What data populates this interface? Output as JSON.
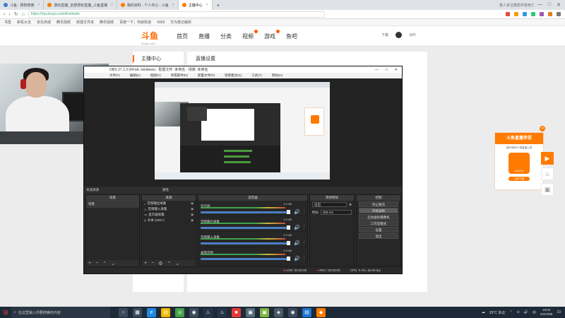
{
  "browser": {
    "tabs": [
      {
        "label": "斗鱼 - 搜狗搜索",
        "active": false
      },
      {
        "label": "游玩直播_全部游玩直播_斗鱼直播",
        "active": false
      },
      {
        "label": "我的资料 - 个人中心 - 斗鱼",
        "active": false
      },
      {
        "label": "主播中心",
        "active": true
      }
    ],
    "new_tab": "+",
    "top_right_text": "老人多注意防中苦死亡",
    "window_controls": [
      "—",
      "□",
      "✕"
    ],
    "url": "https://mp.douyu.com/live/main",
    "bookmarks": [
      "书签",
      "新机大全",
      "京东商城",
      "腾讯视频",
      "新建文件夹",
      "腾讯视频",
      "百度一下，你就知道",
      "4399",
      "华为笔记解析"
    ]
  },
  "site": {
    "logo_text": "斗鱼",
    "logo_sub": "douyu.com",
    "nav": [
      "首页",
      "直播",
      "分类",
      "视频",
      "游戏",
      "鱼吧"
    ],
    "header_right": [
      "下载",
      "马叶"
    ],
    "sidebar_title": "主播中心",
    "content_title": "直播设置",
    "bottom_note": "请勿直接使用本机麦克风进行音频直播"
  },
  "obs": {
    "title": "OBS 27.1.3 (64-bit, windows) - 配置文件: 未命名 - 场景: 未命名",
    "menu": [
      "文件(F)",
      "编辑(E)",
      "视图(V)",
      "停靠部件(D)",
      "配置文件(P)",
      "场景集合(S)",
      "工具(T)",
      "帮助(H)"
    ],
    "status_left": "未选择源",
    "status_mid": "属性",
    "status_filter": "滤镜",
    "docks": {
      "scenes": {
        "title": "场景",
        "items": [
          "场景"
        ]
      },
      "sources": {
        "title": "来源",
        "items": [
          "音频输出采集",
          "音频输入采集",
          "显示器采集",
          "文本 (GDI+)"
        ]
      },
      "mixer": {
        "title": "混音器",
        "tracks": [
          {
            "name": "显示器",
            "db": "0.0 dB"
          },
          {
            "name": "音频输出采集",
            "db": "0.0 dB"
          },
          {
            "name": "音频输入采集",
            "db": "0.0 dB"
          },
          {
            "name": "桌面音频",
            "db": "0.0 dB"
          }
        ]
      },
      "transitions": {
        "title": "转场特效",
        "type": "淡出",
        "duration_label": "时长",
        "duration": "300 ms"
      },
      "controls": {
        "title": "控制",
        "buttons": [
          "停止推流",
          "开始录制",
          "启动虚拟摄像机",
          "工作室模式",
          "设置",
          "退出"
        ]
      }
    },
    "statusbar": {
      "live": "LIVE: 00:00:00",
      "rec": "REC: 00:00:00",
      "cpu": "CPU: 0.4%, 60.00 fps"
    }
  },
  "promo": {
    "title": "斗鱼直播伴侣",
    "sub": "超好用的PC端直播工具",
    "logo_label": "DOUYU",
    "button": "立即下载",
    "close": "✕"
  },
  "taskbar": {
    "search_placeholder": "在这里输入你要搜索的内容",
    "weather": "29°C 多云",
    "time": "19:02",
    "date": "2022/9/8",
    "ime": "中",
    "notif_count": "13"
  },
  "colors": {
    "accent": "#ff7a00",
    "obs_bg": "#2b2b2b",
    "taskbar": "#1f2a38"
  }
}
